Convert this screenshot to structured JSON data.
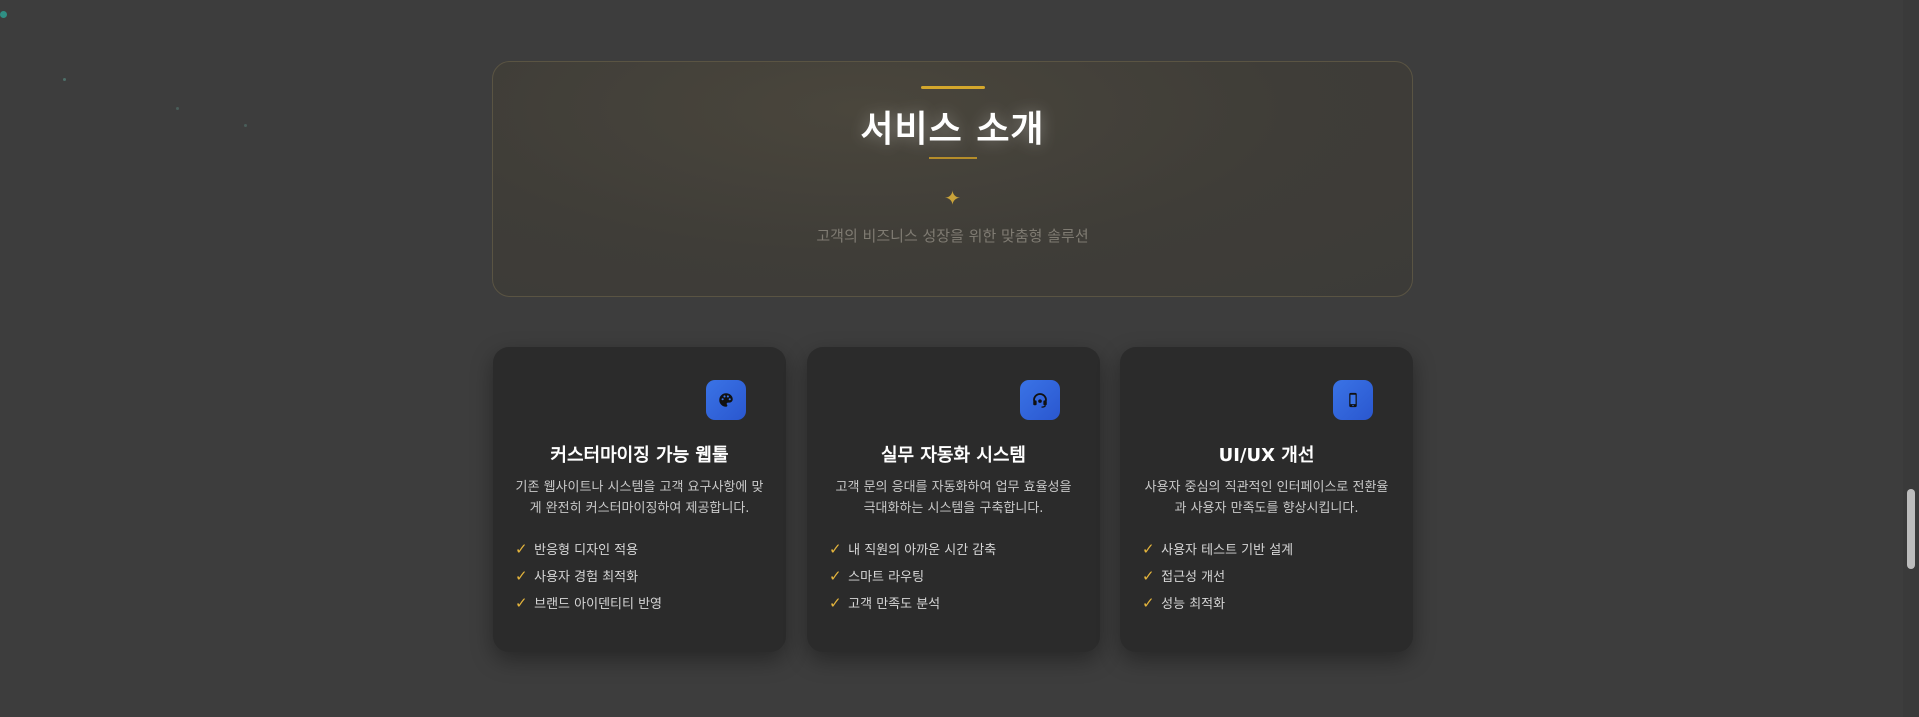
{
  "hero": {
    "title": "서비스 소개",
    "sparkle": "✦",
    "subtitle": "고객의 비즈니스 성장을 위한 맞춤형 솔루션"
  },
  "cards": [
    {
      "icon": "palette-icon",
      "title": "커스터마이징 가능 웹툴",
      "description": "기존 웹사이트나 시스템을 고객 요구사항에 맞게 완전히 커스터마이징하여 제공합니다.",
      "features": [
        "반응형 디자인 적용",
        "사용자 경험 최적화",
        "브랜드 아이덴티티 반영"
      ]
    },
    {
      "icon": "headset-icon",
      "title": "실무 자동화 시스템",
      "description": "고객 문의 응대를 자동화하여 업무 효율성을 극대화하는 시스템을 구축합니다.",
      "features": [
        "내 직원의 아까운 시간 감축",
        "스마트 라우팅",
        "고객 만족도 분석"
      ]
    },
    {
      "icon": "mobile-icon",
      "title": "UI/UX 개선",
      "description": "사용자 중심의 직관적인 인터페이스로 전환율과 사용자 만족도를 향상시킵니다.",
      "features": [
        "사용자 테스트 기반 설계",
        "접근성 개선",
        "성능 최적화"
      ]
    }
  ],
  "check_glyph": "✓",
  "colors": {
    "background": "#3d3d3d",
    "card": "#2b2b2b",
    "accent_gold": "#d4a72c",
    "icon_blue": "#3a73e6"
  }
}
